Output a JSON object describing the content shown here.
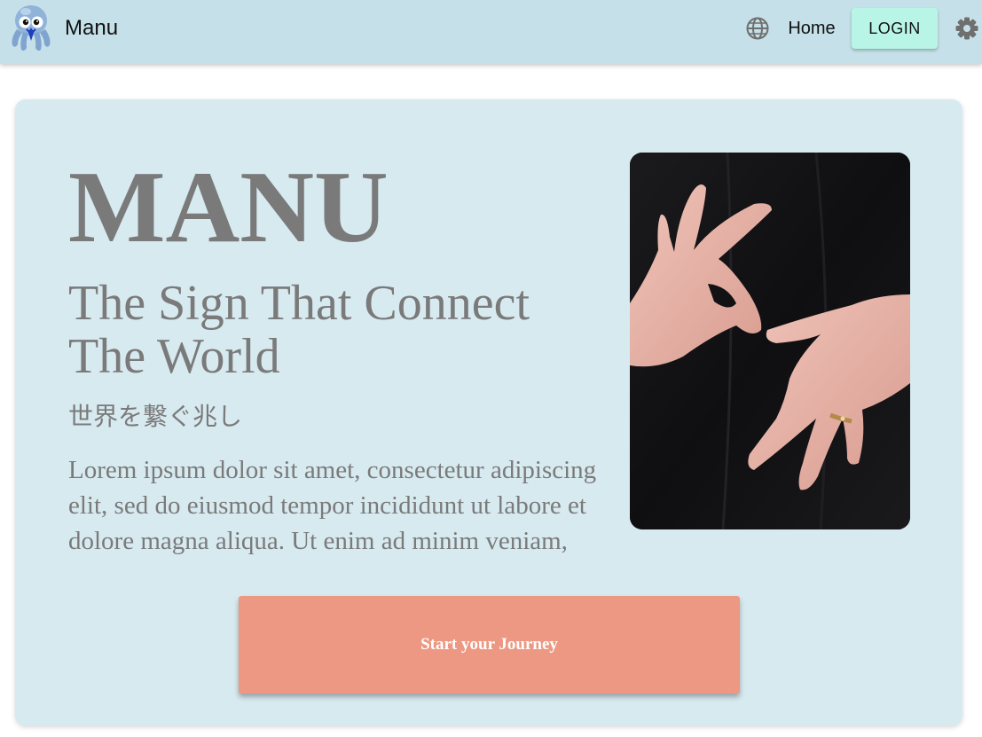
{
  "appbar": {
    "brand": "Manu",
    "logo_icon": "octopus-logo-icon",
    "language_icon": "globe-icon",
    "nav_home": "Home",
    "login_label": "LOGIN",
    "settings_icon": "gear-icon",
    "colors": {
      "background": "#c5e0e8",
      "login_button": "#b8f5e6"
    }
  },
  "hero": {
    "title": "MANU",
    "subtitle": "The Sign That Connect The World",
    "subtitle_jp": "世界を繋ぐ兆し",
    "body": "Lorem ipsum dolor sit amet, consectetur adipiscing elit, sed do eiusmod tempor incididunt ut labore et dolore magna aliqua. Ut enim ad minim veniam,",
    "photo": "sign-language-hands-photo",
    "cta_label": "Start your Journey",
    "colors": {
      "card_background": "#d7eaf0",
      "text": "#7a7a7a",
      "cta_background": "#ec9882"
    }
  }
}
